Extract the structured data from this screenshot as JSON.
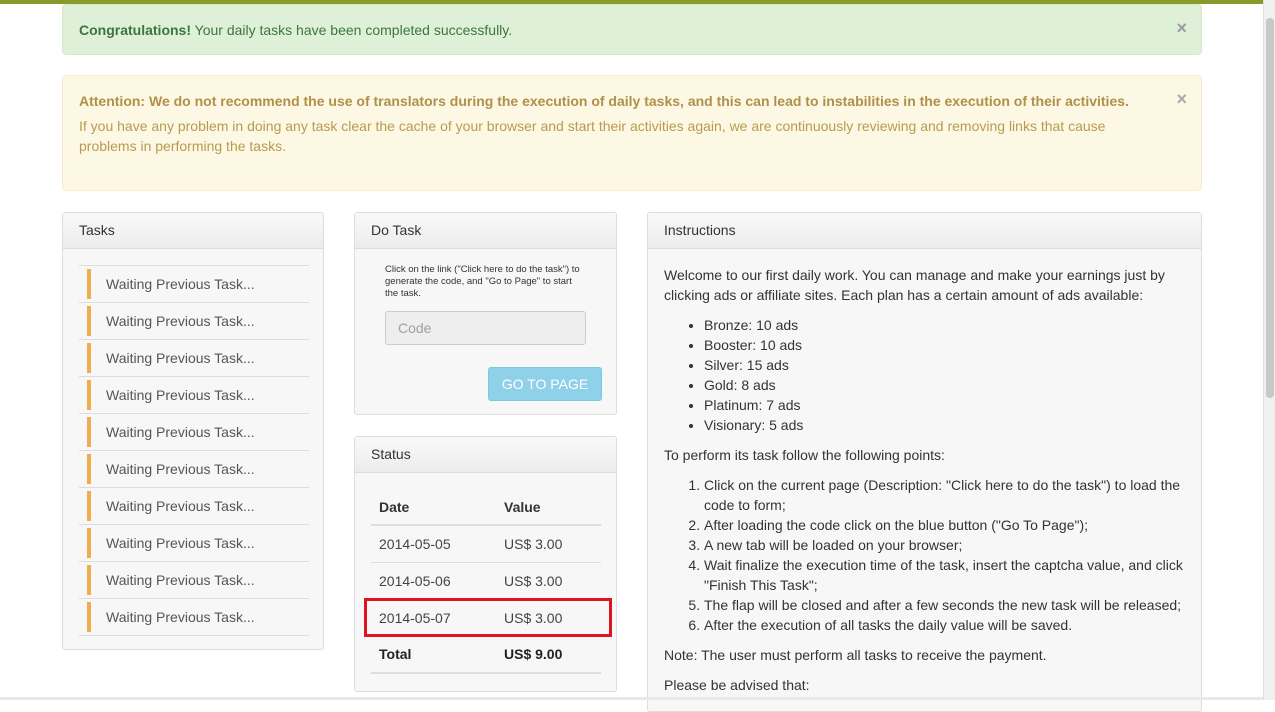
{
  "alerts": {
    "success": {
      "strong": "Congratulations!",
      "text": " Your daily tasks have been completed successfully.",
      "close": "×"
    },
    "warning": {
      "strong": "Attention: We do not recommend the use of translators during the execution of daily tasks, and this can lead to instabilities in the execution of their activities.",
      "text": "If you have any problem in doing any task clear the cache of your browser and start their activities again, we are continuously reviewing and removing links that cause problems in performing the tasks.",
      "close": "×"
    }
  },
  "tasks": {
    "heading": "Tasks",
    "items": [
      "Waiting Previous Task...",
      "Waiting Previous Task...",
      "Waiting Previous Task...",
      "Waiting Previous Task...",
      "Waiting Previous Task...",
      "Waiting Previous Task...",
      "Waiting Previous Task...",
      "Waiting Previous Task...",
      "Waiting Previous Task...",
      "Waiting Previous Task..."
    ]
  },
  "do_task": {
    "heading": "Do Task",
    "hint": "Click on the link (\"Click here to do the task\") to generate the code, and \"Go to Page\" to start the task.",
    "code_placeholder": "Code",
    "go_button": "GO TO PAGE"
  },
  "status": {
    "heading": "Status",
    "col_date": "Date",
    "col_value": "Value",
    "rows": [
      {
        "date": "2014-05-05",
        "value": "US$ 3.00"
      },
      {
        "date": "2014-05-06",
        "value": "US$ 3.00"
      },
      {
        "date": "2014-05-07",
        "value": "US$ 3.00"
      }
    ],
    "total_label": "Total",
    "total_value": "US$ 9.00"
  },
  "instructions": {
    "heading": "Instructions",
    "intro": "Welcome to our first daily work. You can manage and make your earnings just by clicking ads or affiliate sites. Each plan has a certain amount of ads available:",
    "plans": [
      "Bronze: 10 ads",
      "Booster: 10 ads",
      "Silver: 15 ads",
      "Gold: 8 ads",
      "Platinum: 7 ads",
      "Visionary: 5 ads"
    ],
    "steps_intro": "To perform its task follow the following points:",
    "steps": [
      "Click on the current page (Description: \"Click here to do the task\") to load the code to form;",
      "After loading the code click on the blue button (\"Go To Page\");",
      "A new tab will be loaded on your browser;",
      "Wait finalize the execution time of the task, insert the captcha value, and click \"Finish This Task\";",
      "The flap will be closed and after a few seconds the new task will be released;",
      "After the execution of all tasks the daily value will be saved."
    ],
    "note": "Note: The user must perform all tasks to receive the payment.",
    "advised": "Please be advised that:"
  }
}
